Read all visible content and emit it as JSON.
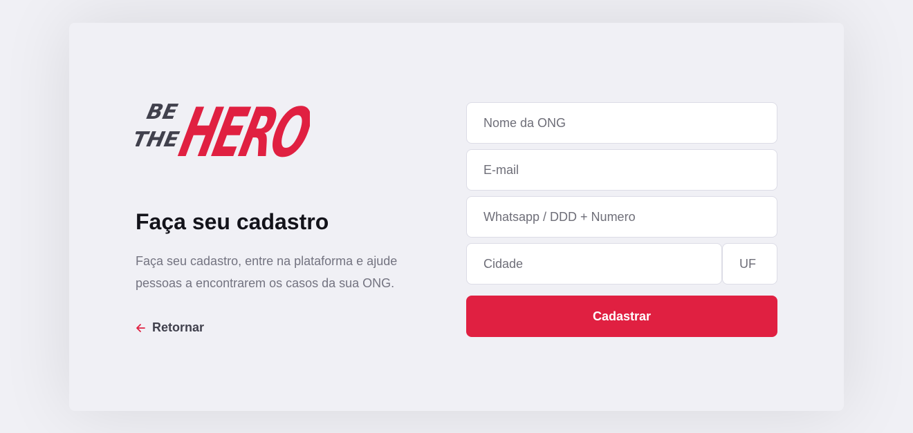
{
  "logo": {
    "line1": "BE",
    "line2": "THE",
    "word": "HERO",
    "colors": {
      "dark": "#41414d",
      "accent": "#e02041"
    }
  },
  "register": {
    "title": "Faça seu cadastro",
    "description": "Faça seu cadastro, entre na plataforma e ajude pessoas a encontrarem os casos da sua ONG.",
    "back_label": "Retornar"
  },
  "form": {
    "name_placeholder": "Nome da ONG",
    "email_placeholder": "E-mail",
    "whatsapp_placeholder": "Whatsapp / DDD + Numero",
    "city_placeholder": "Cidade",
    "uf_placeholder": "UF",
    "submit_label": "Cadastrar"
  },
  "icons": {
    "back": "arrow-left-icon"
  },
  "colors": {
    "accent": "#e02041",
    "background": "#f0f0f5",
    "text": "#13131a",
    "muted": "#737380"
  }
}
